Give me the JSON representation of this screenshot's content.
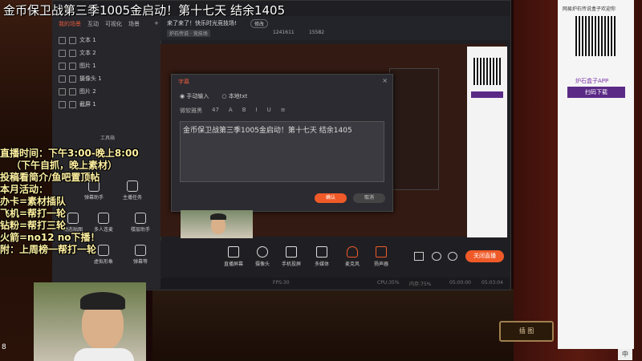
{
  "stream_title": "金币保卫战第三季1005金启动！第十七天 结余1405",
  "overlay_lines": [
    "直播时间：下午3:00-晚上8:00",
    "（下午自抓，晚上素材）",
    "投稿看简介/鱼吧置顶帖",
    "本月活动：",
    "办卡=素材插队",
    "飞机=帮打一轮",
    "钻粉=帮打三轮",
    "火箭=no12 no下播！",
    "附：上周榜一帮打一轮"
  ],
  "left_panel": {
    "tabs": [
      "我的场景",
      "互动",
      "可视化",
      "场景",
      "+"
    ],
    "scenes": [
      "文本 1",
      "文本 2",
      "图片 1",
      "摄像头 1",
      "图片 2",
      "截屏 1"
    ],
    "tools_label": "工具箱",
    "tools": [
      "弹幕助手",
      "主播任务",
      "动态贴图",
      "多人连麦",
      "楼层助手",
      "虚拟形象",
      "弹幕等"
    ]
  },
  "header": {
    "subtitle": "来了来了！快乐时光竞技场!",
    "edit": "修改",
    "category": "炉石传说 · 竞技场",
    "viewers": "1241611",
    "fans": "15582"
  },
  "dialog": {
    "title": "字幕",
    "close": "×",
    "radio_manual": "手动输入",
    "radio_txt": "本地txt",
    "font": "微软雅黑",
    "font_size": "47",
    "text": "金币保卫战第三季1005金启动！第十七天 结余1405",
    "ok": "确认",
    "cancel": "取消"
  },
  "bottom_tools": [
    "直播屏幕",
    "摄像头",
    "手机投屏",
    "多媒体",
    "麦克风",
    "扬声器"
  ],
  "close_stream": "关闭直播",
  "status": {
    "fps": "FPS:30",
    "cpu": "CPU:35%",
    "mem": "内存:75%",
    "time_a": "05:00:00",
    "time_b": "05:03:04"
  },
  "ad": {
    "text": "网易炉石传说盒子欢迎你",
    "brand": "炉石盒子APP",
    "button": "扫码下载"
  },
  "sign": "插 图",
  "counter": "8",
  "ime": "中"
}
